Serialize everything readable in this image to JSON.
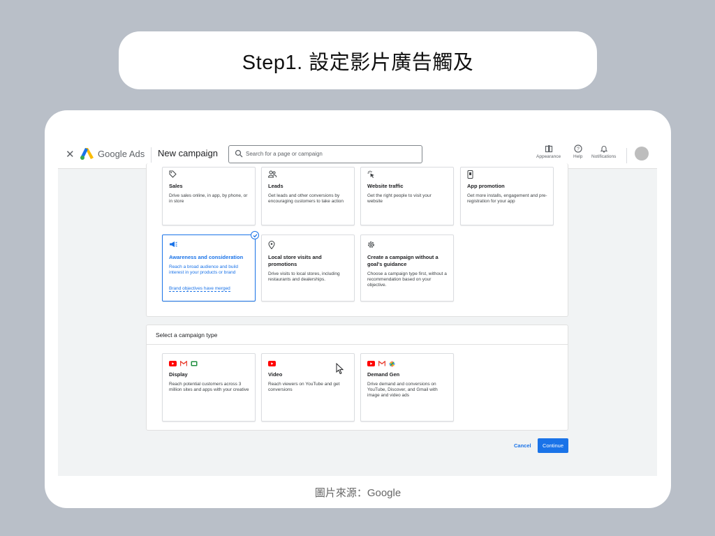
{
  "slide_title": "Step1. 設定影片廣告觸及",
  "caption": "圖片來源：Google",
  "header": {
    "brand": "Google Ads",
    "page_title": "New campaign",
    "search_placeholder": "Search for a page or campaign",
    "tools": [
      "Appearance",
      "Help",
      "Notifications"
    ]
  },
  "goals": [
    {
      "title": "Sales",
      "desc": "Drive sales online, in app, by phone, or in store",
      "icon": "tag-icon"
    },
    {
      "title": "Leads",
      "desc": "Get leads and other conversions by encouraging customers to take action",
      "icon": "people-icon"
    },
    {
      "title": "Website traffic",
      "desc": "Get the right people to visit your website",
      "icon": "cursor-click-icon"
    },
    {
      "title": "App promotion",
      "desc": "Get more installs, engagement and pre-registration for your app",
      "icon": "phone-icon"
    },
    {
      "title": "Awareness and consideration",
      "desc": "Reach a broad audience and build interest in your products or brand",
      "link": "Brand objectives have merged",
      "icon": "megaphone-icon",
      "selected": true
    },
    {
      "title": "Local store visits and promotions",
      "desc": "Drive visits to local stores, including restaurants and dealerships.",
      "icon": "location-pin-icon"
    },
    {
      "title": "Create a campaign without a goal's guidance",
      "desc": "Choose a campaign type first, without a recommendation based on your objective.",
      "icon": "gear-icon"
    }
  ],
  "campaign_section_title": "Select a campaign type",
  "campaign_types": [
    {
      "title": "Display",
      "desc": "Reach potential customers across 3 million sites and apps with your creative"
    },
    {
      "title": "Video",
      "desc": "Reach viewers on YouTube and get conversions"
    },
    {
      "title": "Demand Gen",
      "desc": "Drive demand and conversions on YouTube, Discover, and Gmail with image and video ads"
    }
  ],
  "actions": {
    "cancel": "Cancel",
    "continue": "Continue"
  },
  "colors": {
    "accent": "#1a73e8",
    "youtube": "#ff0000",
    "gmail": "#ea4335",
    "display": "#1e8e3e"
  }
}
